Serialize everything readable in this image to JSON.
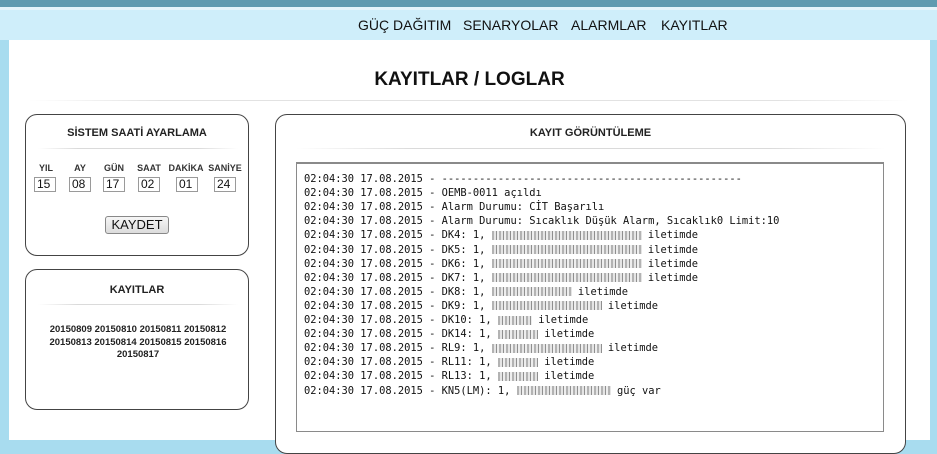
{
  "nav": {
    "items": [
      "GÜÇ DAĞITIM",
      "SENARYOLAR",
      "ALARMLAR",
      "KAYITLAR"
    ]
  },
  "page": {
    "title": "KAYITLAR / LOGLAR"
  },
  "time_panel": {
    "title": "SİSTEM SAATİ AYARLAMA",
    "fields": [
      {
        "label": "YIL",
        "value": "15"
      },
      {
        "label": "AY",
        "value": "08"
      },
      {
        "label": "GÜN",
        "value": "17"
      },
      {
        "label": "SAAT",
        "value": "02"
      },
      {
        "label": "DAKİKA",
        "value": "01"
      },
      {
        "label": "SANİYE",
        "value": "24"
      }
    ],
    "save_label": "KAYDET"
  },
  "records_panel": {
    "title": "KAYITLAR",
    "files": [
      "20150809",
      "20150810",
      "20150811",
      "20150812",
      "20150813",
      "20150814",
      "20150815",
      "20150816",
      "20150817"
    ]
  },
  "viewer": {
    "title": "KAYIT GÖRÜNTÜLEME",
    "lines": [
      "02:04:30 17.08.2015 - ------------------------------------------------",
      "02:04:30 17.08.2015 - OEMB-0011 açıldı",
      "02:04:30 17.08.2015 - Alarm Durumu: CİT Başarılı",
      "02:04:30 17.08.2015 - Alarm Durumu: Sıcaklık Düşük Alarm, Sıcaklık0 Limit:10",
      "02:04:30 17.08.2015 - DK4: 1, ",
      "02:04:30 17.08.2015 - DK5: 1, ",
      "02:04:30 17.08.2015 - DK6: 1, ",
      "02:04:30 17.08.2015 - DK7: 1, ",
      "02:04:30 17.08.2015 - DK8: 1, ",
      "02:04:30 17.08.2015 - DK9: 1, ",
      "02:04:30 17.08.2015 - DK10: 1, ",
      "02:04:30 17.08.2015 - DK14: 1, ",
      "02:04:30 17.08.2015 - RL9: 1, ",
      "02:04:30 17.08.2015 - RL11: 1, ",
      "02:04:30 17.08.2015 - RL13: 1, ",
      "02:04:30 17.08.2015 - KN5(LM): 1, "
    ],
    "line_suffixes": [
      "",
      "",
      "",
      "",
      " iletimde",
      " iletimde",
      " iletimde",
      " iletimde",
      " iletimde",
      " iletimde",
      " iletimde",
      " iletimde",
      " iletimde",
      " iletimde",
      " iletimde",
      " güç var"
    ]
  }
}
